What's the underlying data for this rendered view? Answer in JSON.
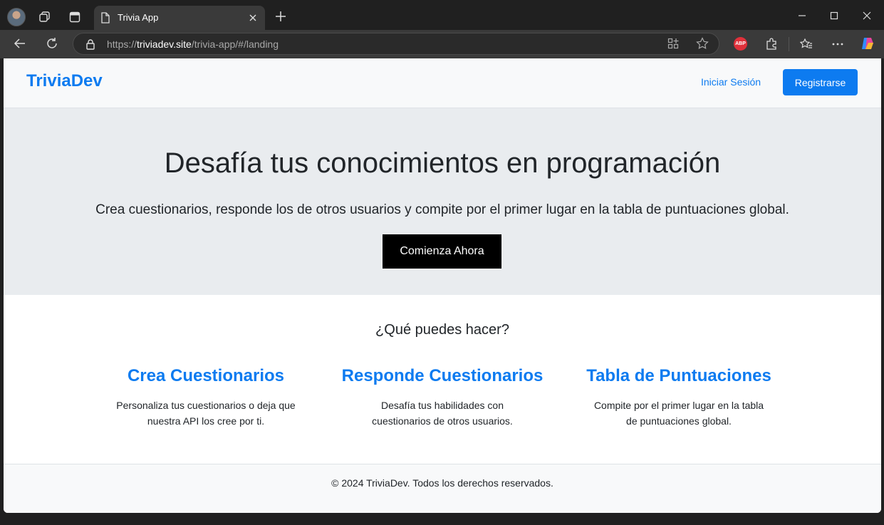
{
  "browser": {
    "tab_title": "Trivia App",
    "url_prefix": "https://",
    "url_host": "triviadev.site",
    "url_path": "/trivia-app/#/landing",
    "adblock_label": "ABP"
  },
  "nav": {
    "brand": "TriviaDev",
    "login_label": "Iniciar Sesión",
    "register_label": "Registrarse"
  },
  "hero": {
    "title": "Desafía tus conocimientos en programación",
    "subtitle": "Crea cuestionarios, responde los de otros usuarios y compite por el primer lugar en la tabla de puntuaciones global.",
    "cta_label": "Comienza Ahora"
  },
  "features": {
    "heading": "¿Qué puedes hacer?",
    "items": [
      {
        "title": "Crea Cuestionarios",
        "text": "Personaliza tus cuestionarios o deja que nuestra API los cree por ti."
      },
      {
        "title": "Responde Cuestionarios",
        "text": "Desafía tus habilidades con cuestionarios de otros usuarios."
      },
      {
        "title": "Tabla de Puntuaciones",
        "text": "Compite por el primer lugar en la tabla de puntuaciones global."
      }
    ]
  },
  "footer": {
    "text": "© 2024 TriviaDev. Todos los derechos reservados."
  },
  "colors": {
    "accent": "#0d7bf0",
    "hero_bg": "#e9ecef",
    "cta_bg": "#000000"
  }
}
